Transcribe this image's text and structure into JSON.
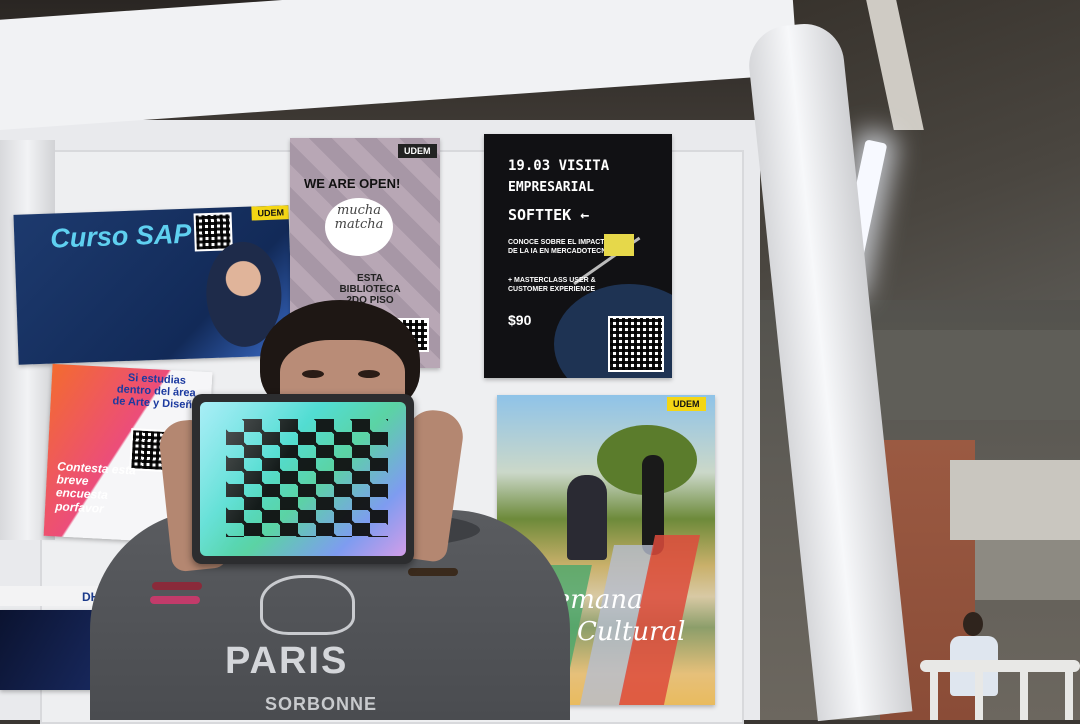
{
  "scene": {
    "poster_sap": {
      "title": "Curso SAP",
      "tag": "UDEM"
    },
    "poster_mucha": {
      "headline": "WE ARE OPEN!",
      "logo_line1": "mucha",
      "logo_line2": "matcha",
      "location_line1": "ESTA",
      "location_line2": "BIBLIOTECA",
      "location_line3": "2DO PISO",
      "tag": "UDEM"
    },
    "poster_softtek": {
      "line1": "19.03  VISITA",
      "line2": "EMPRESARIAL",
      "line3": "SOFTTEK ←",
      "desc1": "CONOCE SOBRE EL IMPACTO DE LA IA EN MERCADOTECNIA",
      "desc2": "+ MASTERCLASS USER & CUSTOMER EXPERIENCE",
      "price": "$90"
    },
    "poster_survey": {
      "heading": "Si estudias dentro del área de Arte y Diseño",
      "body": "Contesta esta breve encuesta porfavor"
    },
    "poster_cultural": {
      "title_line1": "Semana",
      "title_line2": "Cultural",
      "tag": "UDEM"
    },
    "poster_dh": {
      "logo": "DH"
    },
    "hoodie": {
      "text": "PARIS",
      "subtext": "SORBONNE"
    }
  },
  "colors": {
    "udem_tag": "#f4d615",
    "softtek_bg": "#111114",
    "sap_bg": "#1d3a6e",
    "hoodie": "#4a4c50",
    "checkerboard_dark": "#111111"
  },
  "checkerboard": {
    "columns": 9,
    "rows": 9
  }
}
